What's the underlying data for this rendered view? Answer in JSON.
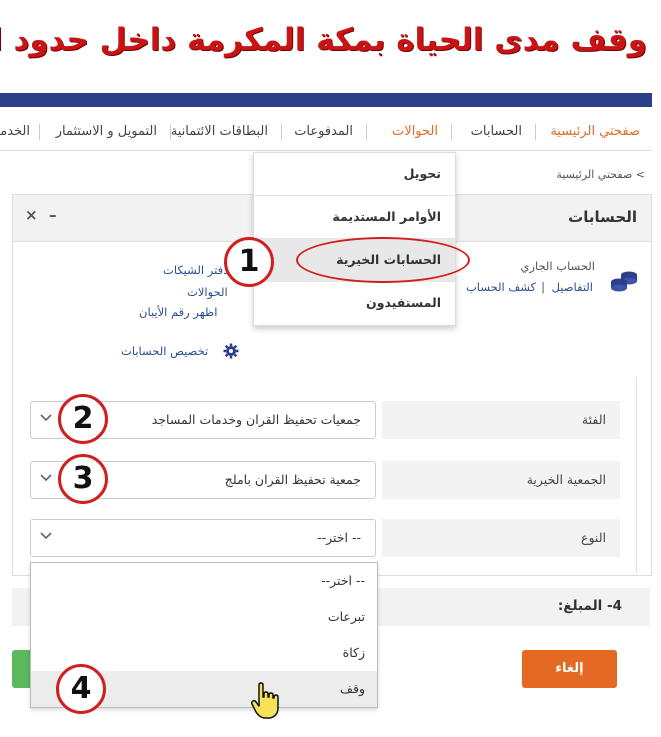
{
  "banner": {
    "title": "وقف مدى الحياة بمكة المكرمة داخل حدود الحرم"
  },
  "nav": {
    "items": [
      {
        "label": "صفحتي الرئيسية",
        "active": true
      },
      {
        "label": "الحسابات",
        "active": false
      },
      {
        "label": "الحوالات",
        "active": true
      },
      {
        "label": "المدفوعات",
        "active": false
      },
      {
        "label": "البطاقات الائتمانية",
        "active": false
      },
      {
        "label": "التمويل و الاستثمار",
        "active": false
      },
      {
        "label": "الخدما",
        "active": false
      }
    ]
  },
  "submenu": {
    "items": [
      "تحويل",
      "الأوامر المستديمة",
      "الحسابات الخيرية",
      "المستفيدون"
    ]
  },
  "breadcrumb": "> صفحتي الرئيسية",
  "panel": {
    "title": "الحسابات",
    "minimize": "–",
    "close": "×",
    "account_type": "الحساب الجاري",
    "details_link": "التفاصيل",
    "statement_link": "كشف الحساب",
    "link_separator": "|",
    "quick_links": [
      "دفتر الشيكات",
      "الحوالات",
      "اظهر رقم الأيبان"
    ],
    "customize_label": "تخصيص الحسابات"
  },
  "form": {
    "category": {
      "label": "الفئة",
      "value": "جمعيات تحفيظ القران وخدمات المساجد"
    },
    "charity": {
      "label": "الجمعية الخيرية",
      "value": "جمعية تحفيظ القران باملج"
    },
    "type": {
      "label": "النوع",
      "value": "-- اختر--",
      "options": [
        "-- اختر--",
        "تبرعات",
        "زكاة",
        "وقف"
      ]
    }
  },
  "amount": {
    "label": "4- المبلغ:"
  },
  "buttons": {
    "cancel": "إلغاء"
  },
  "annotations": [
    "1",
    "2",
    "3",
    "4"
  ],
  "colors": {
    "accent": "#e46a24",
    "nav_bar": "#2b3f8a",
    "title_red": "#c81414",
    "annotation_red": "#d01f1f",
    "link": "#2a4f8f",
    "green": "#5cb85c"
  }
}
